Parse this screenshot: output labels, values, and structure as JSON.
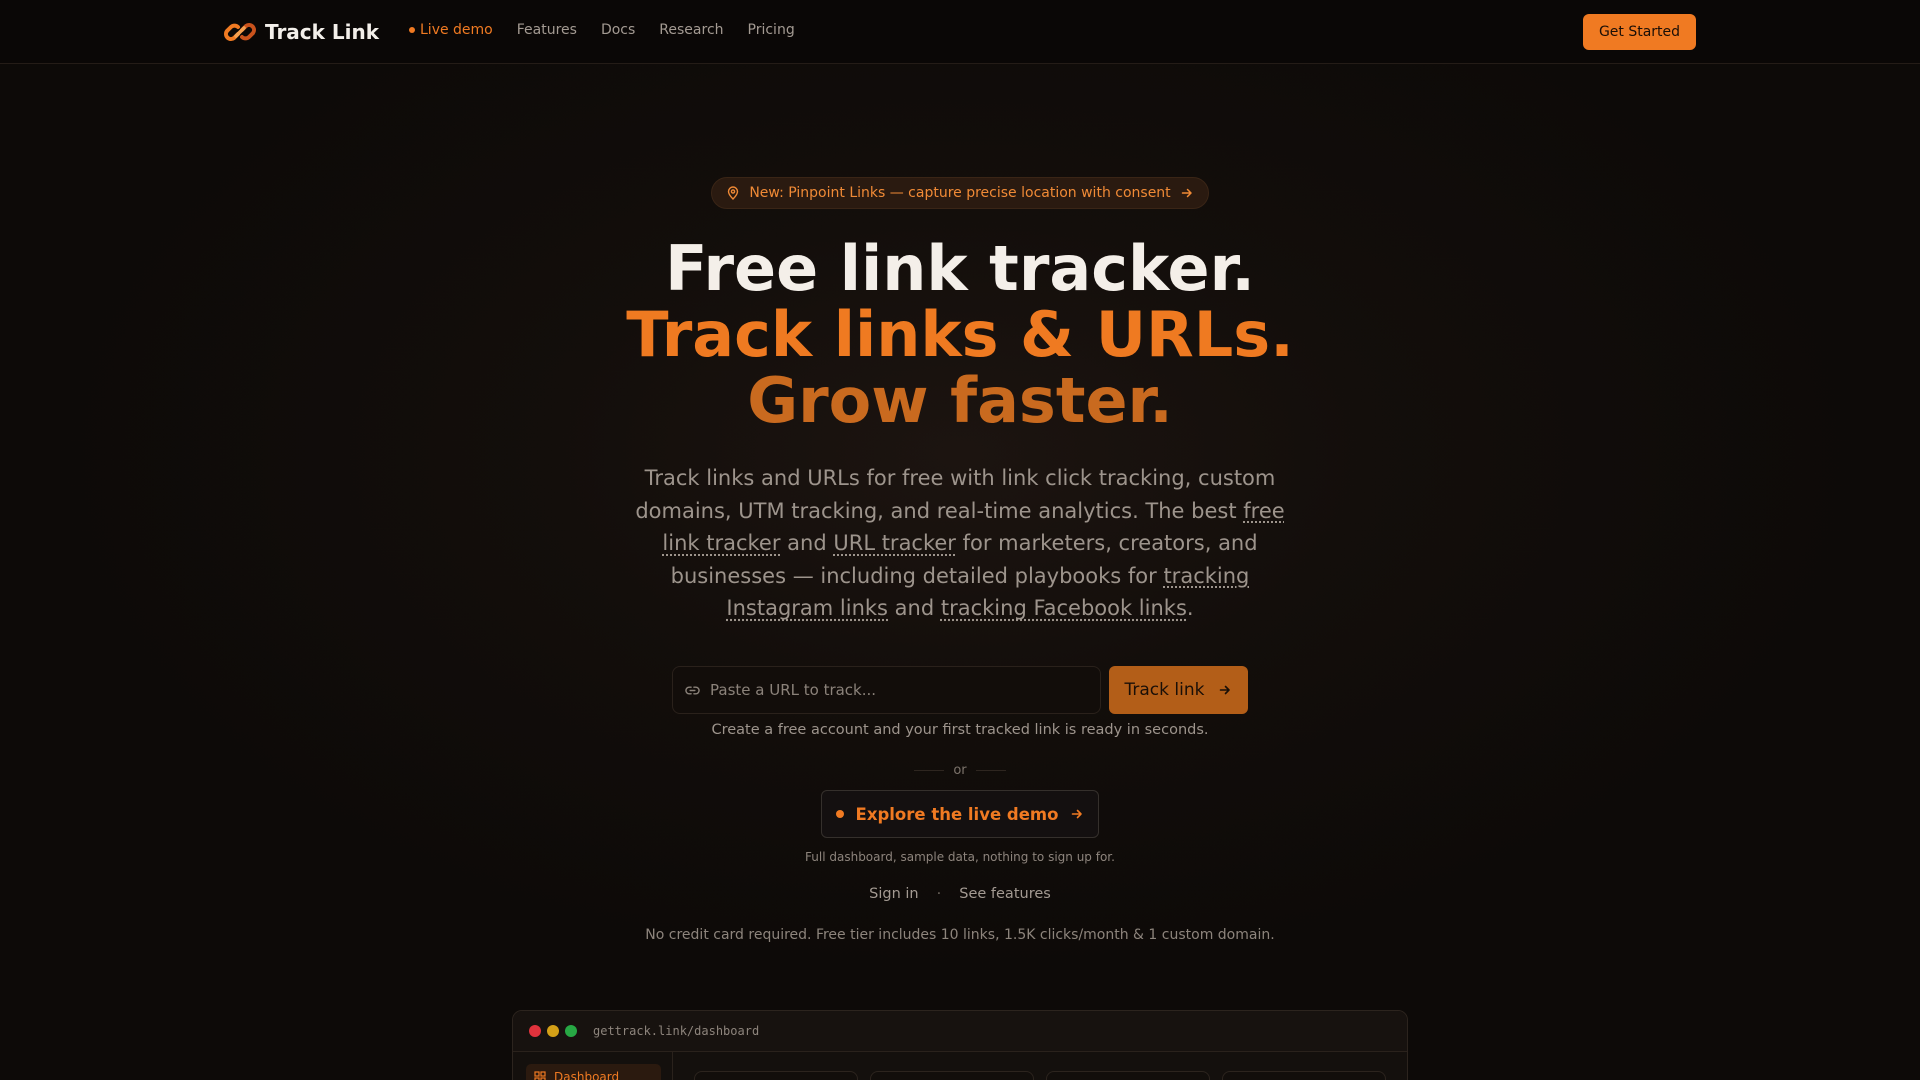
{
  "nav": {
    "brand": "Track Link",
    "links": [
      {
        "label": "Live demo",
        "live": true
      },
      {
        "label": "Features"
      },
      {
        "label": "Docs"
      },
      {
        "label": "Research"
      },
      {
        "label": "Pricing"
      }
    ],
    "cta": "Get Started"
  },
  "announcement": {
    "text": "New: Pinpoint Links — capture precise location with consent",
    "icons": [
      "map-pin-icon",
      "arrow-right-icon"
    ]
  },
  "hero": {
    "line1": "Free link tracker.",
    "line2": "Track links & URLs.",
    "line3": "Grow faster.",
    "sub": {
      "p1": "Track links and URLs for free with link click tracking, custom domains, UTM tracking, and real-time analytics. The best ",
      "link1": "free link tracker",
      "p2": " and ",
      "link2": "URL tracker",
      "p3": " for marketers, creators, and businesses — including detailed playbooks for ",
      "link3": "tracking Instagram links",
      "p4": " and ",
      "link4": "tracking Facebook links",
      "p5": "."
    }
  },
  "tracker": {
    "placeholder": "Paste a URL to track...",
    "button": "Track link",
    "helper": "Create a free account and your first tracked link is ready in seconds."
  },
  "divider": "or",
  "demo": {
    "button": "Explore the live demo",
    "helper": "Full dashboard, sample data, nothing to sign up for."
  },
  "auth": {
    "signin": "Sign in",
    "separator": "·",
    "features": "See features"
  },
  "fine_print": "No credit card required. Free tier includes 10 links, 1.5K clicks/month & 1 custom domain.",
  "preview": {
    "url": "gettrack.link/dashboard",
    "sidebar_item": "Dashboard"
  },
  "colors": {
    "accent": "#f07a22",
    "background": "#0f0b09",
    "traffic_red": "#e0323c",
    "traffic_yellow": "#d4a017",
    "traffic_green": "#27a844"
  }
}
